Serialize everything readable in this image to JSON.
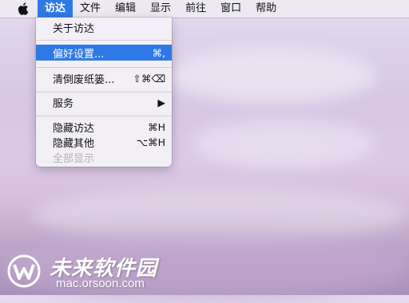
{
  "menubar": {
    "apple_icon": "apple-icon",
    "items": [
      "访达",
      "文件",
      "编辑",
      "显示",
      "前往",
      "窗口",
      "帮助"
    ]
  },
  "finder_menu": {
    "about": "关于访达",
    "preferences": {
      "label": "偏好设置...",
      "shortcut": "⌘,"
    },
    "empty_trash": {
      "label": "清倒废纸篓...",
      "shortcut": "⇧⌘⌫"
    },
    "services": {
      "label": "服务",
      "arrow": "▶"
    },
    "hide": {
      "label": "隐藏访达",
      "shortcut": "⌘H"
    },
    "hide_others": {
      "label": "隐藏其他",
      "shortcut": "⌥⌘H"
    },
    "show_all": "全部显示"
  },
  "watermark": {
    "title": "未来软件园",
    "url": "mac.orsoon.com"
  },
  "colors": {
    "highlight": "#2f79e6"
  }
}
